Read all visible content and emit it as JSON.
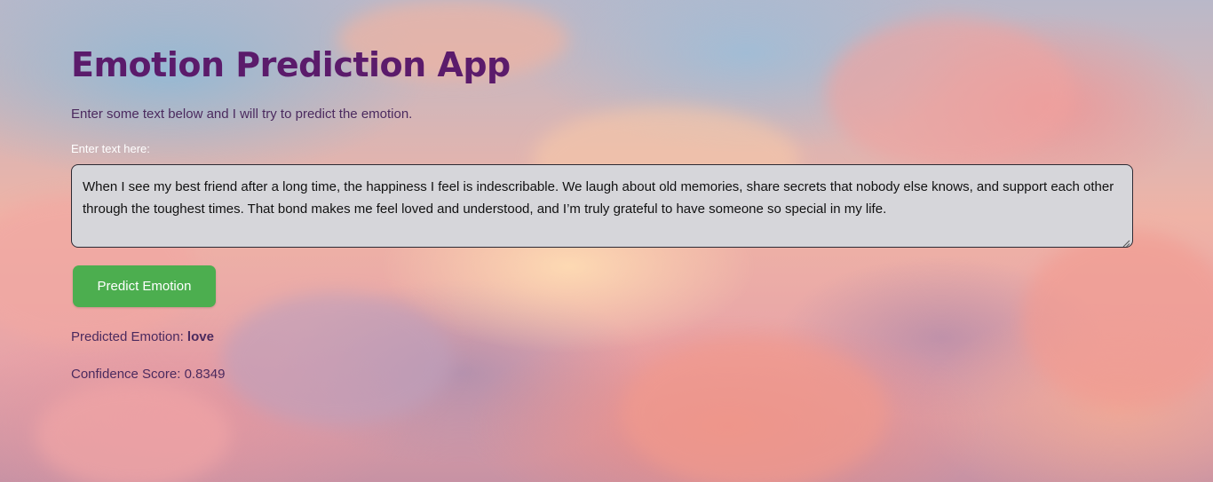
{
  "app": {
    "title": "Emotion Prediction App",
    "subtitle": "Enter some text below and I will try to predict the emotion."
  },
  "input": {
    "label": "Enter text here:",
    "value": "When I see my best friend after a long time, the happiness I feel is indescribable. We laugh about old memories, share secrets that nobody else knows, and support each other through the toughest times. That bond makes me feel loved and understood, and I’m truly grateful to have someone so special in my life."
  },
  "actions": {
    "predict_label": "Predict Emotion"
  },
  "result": {
    "emotion_label": "Predicted Emotion:",
    "emotion_value": "love",
    "confidence_label": "Confidence Score:",
    "confidence_value": "0.8349"
  },
  "colors": {
    "title": "#5b1b6b",
    "text": "#4b2a5e",
    "button": "#4cae4f",
    "textarea_bg": "#d6d6da"
  },
  "icons": {
    "resize_handle": "resize-handle-icon"
  }
}
